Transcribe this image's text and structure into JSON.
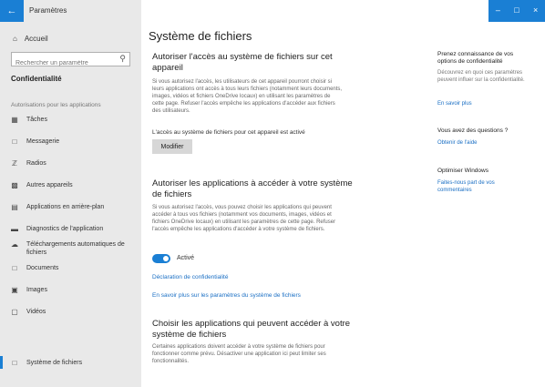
{
  "window": {
    "title": "Paramètres",
    "controls": [
      "–",
      "□",
      "×"
    ]
  },
  "sidebar": {
    "home_label": "Accueil",
    "search_placeholder": "Rechercher un paramètre",
    "section_title": "Confidentialité",
    "group_label": "Autorisations pour les applications",
    "items": [
      {
        "label": "Tâches",
        "icon": "tasks-icon"
      },
      {
        "label": "Messagerie",
        "icon": "chat-icon"
      },
      {
        "label": "Radios",
        "icon": "radio-icon"
      },
      {
        "label": "Autres appareils",
        "icon": "devices-icon"
      },
      {
        "label": "Applications en arrière-plan",
        "icon": "background-apps-icon"
      },
      {
        "label": "Diagnostics de l'application",
        "icon": "diagnostics-icon"
      },
      {
        "label": "Téléchargements automatiques de fichiers",
        "icon": "cloud-download-icon"
      },
      {
        "label": "Documents",
        "icon": "document-icon"
      },
      {
        "label": "Images",
        "icon": "image-icon"
      },
      {
        "label": "Vidéos",
        "icon": "video-icon"
      },
      {
        "label": "Système de fichiers",
        "icon": "file-system-icon",
        "active": true
      }
    ]
  },
  "main": {
    "page_title": "Système de fichiers",
    "section1": {
      "heading": "Autoriser l'accès au système de fichiers sur cet appareil",
      "body": "Si vous autorisez l'accès, les utilisateurs de cet appareil pourront choisir si leurs applications ont accès à tous leurs fichiers (notamment leurs documents, images, vidéos et fichiers OneDrive locaux) en utilisant les paramètres de cette page. Refuser l'accès empêche les applications d'accéder aux fichiers des utilisateurs.",
      "status": "L'accès au système de fichiers pour cet appareil est activé",
      "button": "Modifier"
    },
    "section2": {
      "heading": "Autoriser les applications à accéder à votre système de fichiers",
      "body": "Si vous autorisez l'accès, vous pouvez choisir les applications qui peuvent accéder à tous vos fichiers (notamment vos documents, images, vidéos et fichiers OneDrive locaux) en utilisant les paramètres de cette page. Refuser l'accès empêche les applications d'accéder à votre système de fichiers.",
      "toggle_state": "Activé",
      "link_privacy": "Déclaration de confidentialité",
      "link_more": "En savoir plus sur les paramètres du système de fichiers"
    },
    "section3": {
      "heading": "Choisir les applications qui peuvent accéder à votre système de fichiers",
      "body": "Certaines applications doivent accéder à votre système de fichiers pour fonctionner comme prévu. Désactiver une application ici peut limiter ses fonctionnalités."
    }
  },
  "right_panel": {
    "block1_heading": "Prenez connaissance de vos options de confidentialité",
    "block1_body": "Découvrez en quoi ces paramètres peuvent influer sur la confidentialité.",
    "block1_link": "En savoir plus",
    "block2_heading": "Vous avez des questions ?",
    "block2_link": "Obtenir de l'aide",
    "block3_heading": "Optimiser Windows",
    "block3_link": "Faites-nous part de vos commentaires"
  },
  "colors": {
    "accent": "#1a7fd4",
    "sidebar_bg": "#e9e9e9",
    "link": "#1a6fc4"
  }
}
